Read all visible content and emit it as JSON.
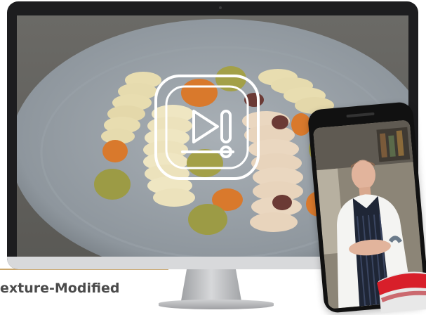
{
  "caption": {
    "text": "exture-Modified"
  },
  "icons": {
    "monitor": "desktop-monitor-icon",
    "video_play": "video-play-icon",
    "phone": "smartphone-icon"
  },
  "colors": {
    "accent_rule": "#c9a56a",
    "caption": "#4b4b4b",
    "play_icon": "#ffffff"
  }
}
